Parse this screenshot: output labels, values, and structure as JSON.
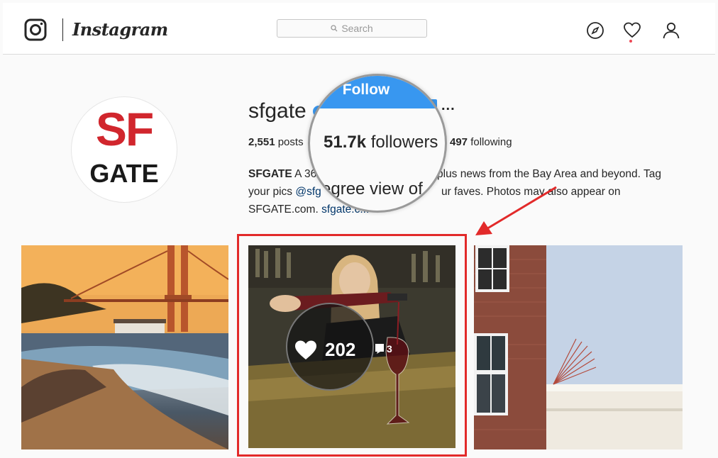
{
  "header": {
    "brand": "Instagram",
    "search_placeholder": "Search"
  },
  "profile": {
    "username": "sfgate",
    "avatar_top": "SF",
    "avatar_bottom": "GATE",
    "follow_label": "Follow",
    "more_label": "...",
    "posts_count": "2,551",
    "posts_label": "posts",
    "followers_count": "51.7k",
    "followers_label": "followers",
    "following_count": "497",
    "following_label": "following",
    "bio_name": "SFGATE",
    "bio_line1_a": "A 36",
    "bio_line1_b": "plus news from the Bay Area and beyond. Tag",
    "bio_line2_a": "your pics",
    "bio_line2_handle": "@sfg",
    "bio_line2_b": "ur faves. Photos may also appear on",
    "bio_line3_a": "SFGATE.com.",
    "bio_line3_link": "sfgate.c...",
    "magnified_bio": "egree view of"
  },
  "post": {
    "likes": "202",
    "comments": "3"
  },
  "colors": {
    "follow_blue": "#3897f0",
    "highlight_red": "#e22a2a",
    "brand_red": "#d1262d"
  }
}
